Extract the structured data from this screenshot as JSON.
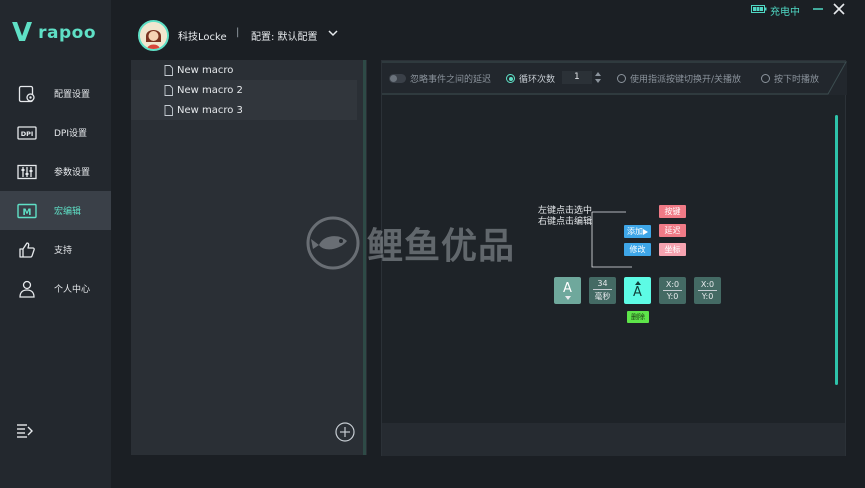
{
  "brand": {
    "logo_letter": "V",
    "name": "rapoo"
  },
  "nav": {
    "items": [
      {
        "label": "配置设置",
        "icon": "config-settings-icon"
      },
      {
        "label": "DPI设置",
        "icon": "dpi-icon"
      },
      {
        "label": "参数设置",
        "icon": "parameters-icon"
      },
      {
        "label": "宏编辑",
        "icon": "macro-icon",
        "active": true
      },
      {
        "label": "支持",
        "icon": "thumbs-up-icon"
      },
      {
        "label": "个人中心",
        "icon": "user-icon"
      }
    ]
  },
  "header": {
    "user_name": "科技Locke",
    "separator": "|",
    "config_label": "配置: 默认配置",
    "battery_status": "充电中"
  },
  "macros": {
    "items": [
      "New macro",
      "New macro 2",
      "New macro 3"
    ]
  },
  "options": {
    "ignore_delay": "忽略事件之间的延迟",
    "loop_count_label": "循环次数",
    "loop_count_value": "1",
    "toggle_by_key": "使用指派按键切换开/关播放",
    "play_while_pressed": "按下时播放"
  },
  "editor": {
    "hint_line1": "左键点击选中",
    "hint_line2": "右键点击编辑",
    "menu": {
      "add": "添加",
      "modify": "修改",
      "key": "按键",
      "delay": "延迟",
      "coordinate": "坐标"
    },
    "sequence": {
      "key1": "A",
      "delay_value": "34",
      "delay_unit": "毫秒",
      "key2": "A",
      "coord1_x": "X:0",
      "coord1_y": "Y:0",
      "coord2_x": "X:0",
      "coord2_y": "Y:0"
    },
    "delete_label": "删除"
  },
  "watermark": {
    "text": "鲤鱼优品"
  },
  "colors": {
    "accent": "#5fe0c6",
    "sidebar": "#23282e",
    "background": "#1b1f24"
  }
}
